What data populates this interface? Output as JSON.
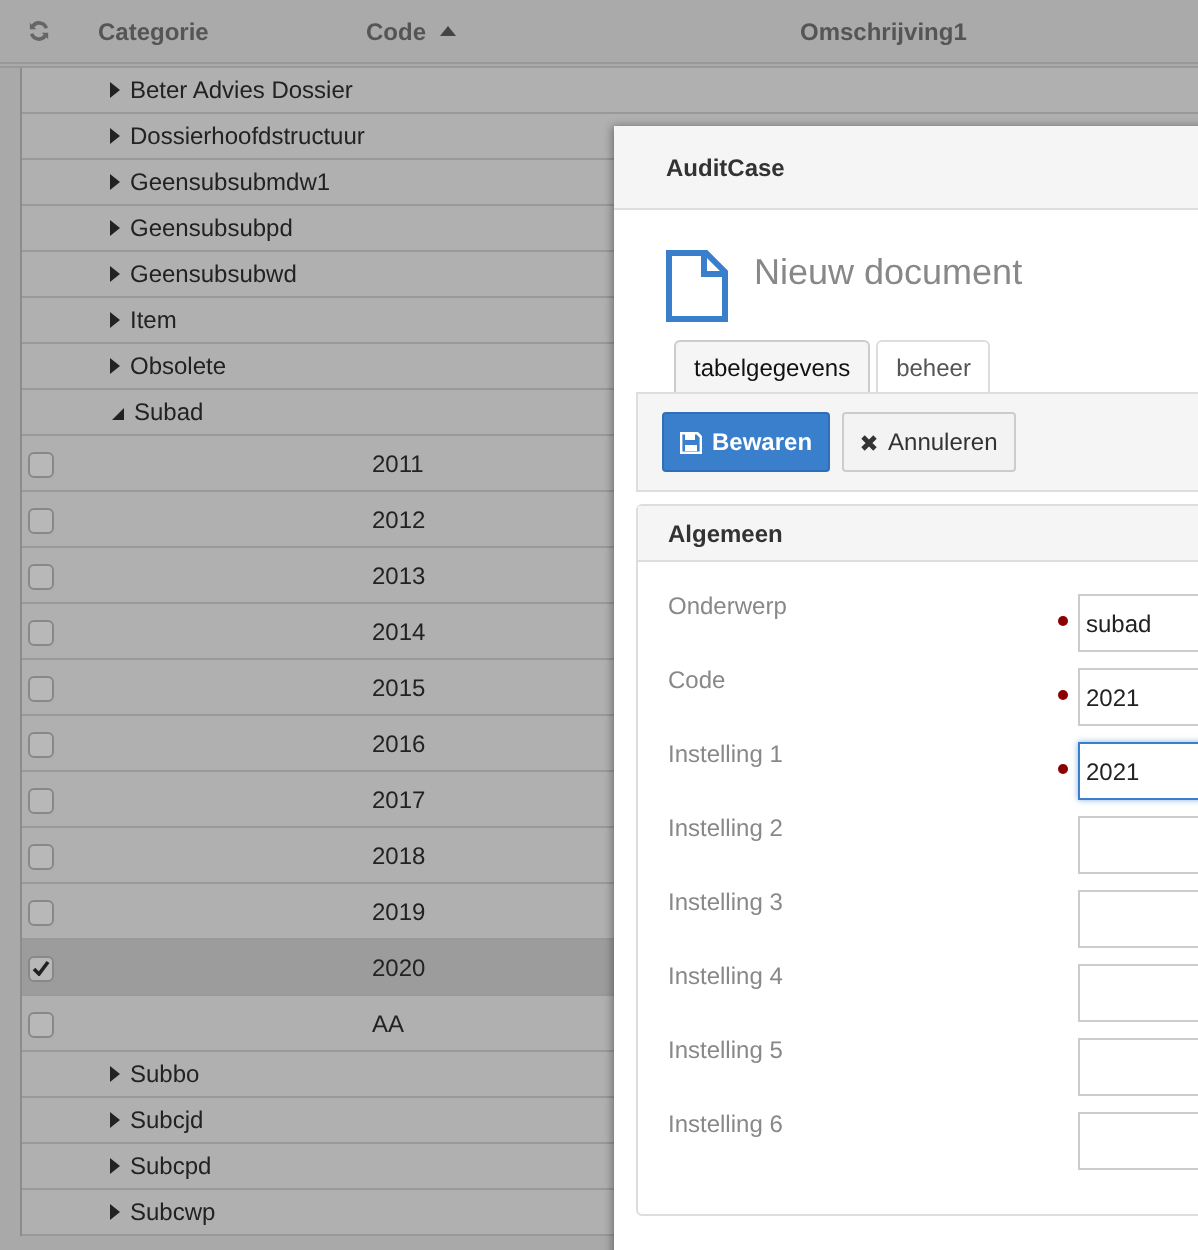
{
  "grid": {
    "columns": [
      {
        "label": "Categorie",
        "sorted": false
      },
      {
        "label": "Code",
        "sorted": true
      },
      {
        "label": "Omschrijving1",
        "sorted": false
      }
    ],
    "rows": [
      {
        "kind": "group",
        "label": "Beter Advies Dossier",
        "expanded": false
      },
      {
        "kind": "group",
        "label": "Dossierhoofdstructuur",
        "expanded": false
      },
      {
        "kind": "group",
        "label": "Geensubsubmdw1",
        "expanded": false
      },
      {
        "kind": "group",
        "label": "Geensubsubpd",
        "expanded": false
      },
      {
        "kind": "group",
        "label": "Geensubsubwd",
        "expanded": false
      },
      {
        "kind": "group",
        "label": "Item",
        "expanded": false
      },
      {
        "kind": "group",
        "label": "Obsolete",
        "expanded": false
      },
      {
        "kind": "group",
        "label": "Subad",
        "expanded": true
      },
      {
        "kind": "item",
        "code": "2011",
        "checked": false,
        "selected": false
      },
      {
        "kind": "item",
        "code": "2012",
        "checked": false,
        "selected": false
      },
      {
        "kind": "item",
        "code": "2013",
        "checked": false,
        "selected": false
      },
      {
        "kind": "item",
        "code": "2014",
        "checked": false,
        "selected": false
      },
      {
        "kind": "item",
        "code": "2015",
        "checked": false,
        "selected": false
      },
      {
        "kind": "item",
        "code": "2016",
        "checked": false,
        "selected": false
      },
      {
        "kind": "item",
        "code": "2017",
        "checked": false,
        "selected": false
      },
      {
        "kind": "item",
        "code": "2018",
        "checked": false,
        "selected": false
      },
      {
        "kind": "item",
        "code": "2019",
        "checked": false,
        "selected": false
      },
      {
        "kind": "item",
        "code": "2020",
        "checked": true,
        "selected": true
      },
      {
        "kind": "item",
        "code": "AA",
        "checked": false,
        "selected": false
      },
      {
        "kind": "group",
        "label": "Subbo",
        "expanded": false
      },
      {
        "kind": "group",
        "label": "Subcjd",
        "expanded": false
      },
      {
        "kind": "group",
        "label": "Subcpd",
        "expanded": false
      },
      {
        "kind": "group",
        "label": "Subcwp",
        "expanded": false
      }
    ]
  },
  "dialog": {
    "title": "AuditCase",
    "heading": "Nieuw document",
    "tabs": [
      {
        "label": "tabelgegevens",
        "selected": true
      },
      {
        "label": "beheer",
        "selected": false
      }
    ],
    "buttons": [
      {
        "kind": "primary",
        "label": "Bewaren"
      },
      {
        "kind": "cancel",
        "label": "Annuleren"
      }
    ],
    "section": {
      "title": "Algemeen",
      "fields": [
        {
          "label": "Onderwerp",
          "value": "subad",
          "required": true,
          "focused": false
        },
        {
          "label": "Code",
          "value": "2021",
          "required": true,
          "focused": false
        },
        {
          "label": "Instelling 1",
          "value": "2021",
          "required": true,
          "focused": true
        },
        {
          "label": "Instelling 2",
          "required": false,
          "focused": false
        },
        {
          "label": "Instelling 3",
          "required": false,
          "focused": false
        },
        {
          "label": "Instelling 4",
          "required": false,
          "focused": false
        },
        {
          "label": "Instelling 5",
          "required": false,
          "focused": false
        },
        {
          "label": "Instelling 6",
          "required": false,
          "focused": false
        }
      ]
    }
  }
}
